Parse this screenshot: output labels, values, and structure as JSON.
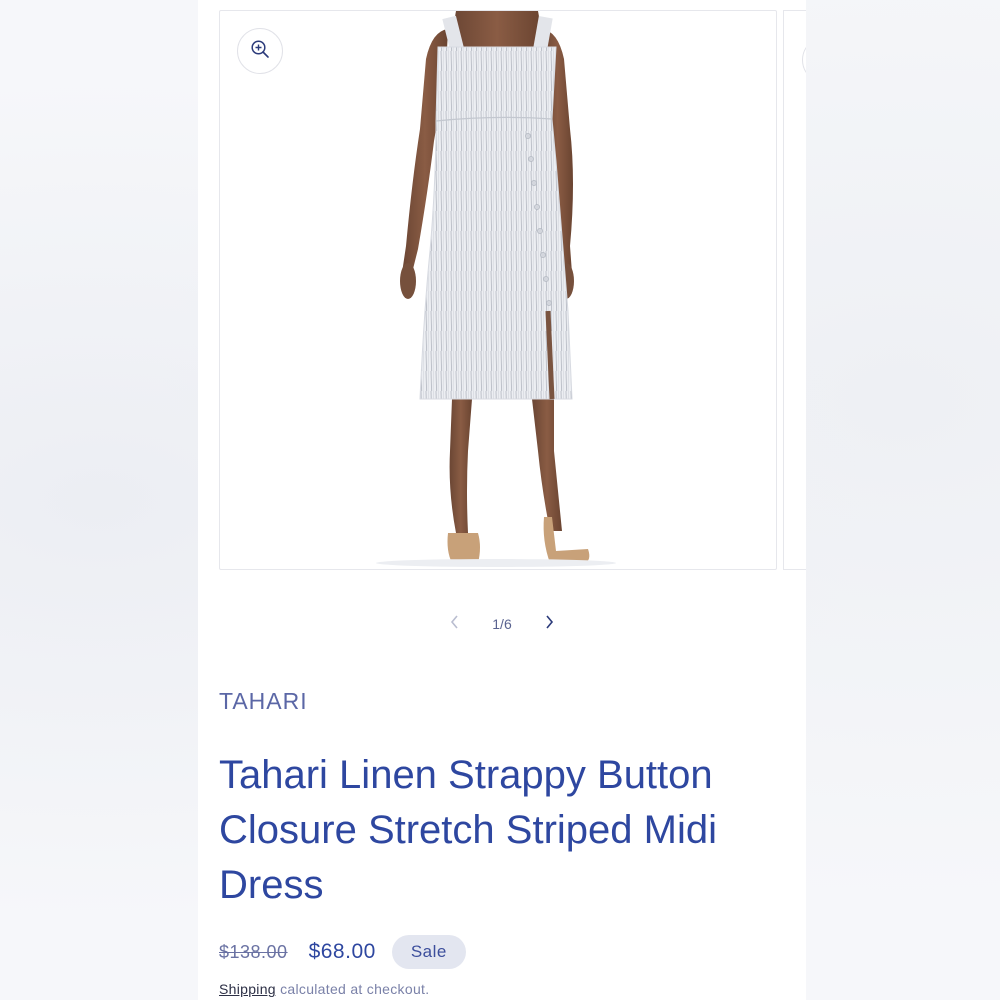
{
  "gallery": {
    "counter": "1/6",
    "zoom_icon": "zoom-in-icon",
    "prev_icon": "chevron-left-icon",
    "next_icon": "chevron-right-icon"
  },
  "product": {
    "vendor": "TAHARI",
    "title": "Tahari Linen Strappy Button Closure Stretch Striped Midi Dress",
    "price_regular": "$138.00",
    "price_sale": "$68.00",
    "sale_badge": "Sale",
    "shipping_link": "Shipping",
    "shipping_note": "calculated at checkout."
  },
  "colors": {
    "accent": "#2e47a0",
    "vendor": "#5b67a6",
    "badge_bg": "#e3e6f0"
  }
}
